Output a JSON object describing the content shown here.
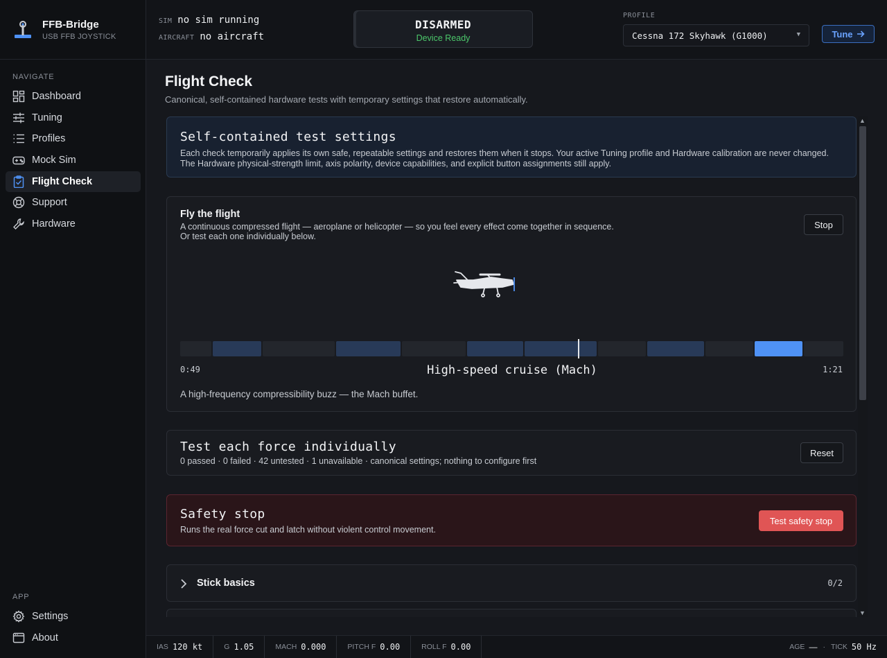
{
  "brand": {
    "name": "FFB-Bridge",
    "subtitle": "USB FFB JOYSTICK"
  },
  "sidebar": {
    "nav_label": "NAVIGATE",
    "items": [
      {
        "label": "Dashboard",
        "icon": "grid-icon"
      },
      {
        "label": "Tuning",
        "icon": "sliders-icon"
      },
      {
        "label": "Profiles",
        "icon": "list-icon"
      },
      {
        "label": "Mock Sim",
        "icon": "gamepad-icon"
      },
      {
        "label": "Flight Check",
        "icon": "clipboard-check-icon",
        "active": true
      },
      {
        "label": "Support",
        "icon": "lifebuoy-icon"
      },
      {
        "label": "Hardware",
        "icon": "wrench-icon"
      }
    ],
    "app_label": "APP",
    "app_items": [
      {
        "label": "Settings",
        "icon": "gear-icon"
      },
      {
        "label": "About",
        "icon": "window-icon"
      }
    ]
  },
  "header": {
    "sim_key": "SIM",
    "sim_value": "no sim running",
    "aircraft_key": "AIRCRAFT",
    "aircraft_value": "no aircraft",
    "arm_state": "DISARMED",
    "arm_status": "Device Ready",
    "profile_label": "PROFILE",
    "profile_value": "Cessna 172 Skyhawk (G1000)",
    "tune_label": "Tune"
  },
  "page": {
    "title": "Flight Check",
    "subtitle": "Canonical, self-contained hardware tests with temporary settings that restore automatically."
  },
  "settings_card": {
    "title": "Self-contained test settings",
    "text": "Each check temporarily applies its own safe, repeatable settings and restores them when it stops. Your active Tuning profile and Hardware calibration are never changed. The Hardware physical-strength limit, axis polarity, device capabilities, and explicit button assignments still apply."
  },
  "flight_card": {
    "title": "Fly the flight",
    "line1": "A continuous compressed flight — aeroplane or helicopter — so you feel every effect come together in sequence.",
    "line2": "Or test each one individually below.",
    "stop_label": "Stop",
    "elapsed": "0:49",
    "total": "1:21",
    "progress_fraction": 0.6,
    "phase": "High-speed cruise (Mach)",
    "phase_desc": "A high-frequency compressibility buzz — the Mach buffet.",
    "colors": {
      "segment_off": "#23262c",
      "segment_on": "#283a58",
      "segment_current": "#4f92f5"
    }
  },
  "individual_card": {
    "title": "Test each force individually",
    "summary": "0 passed · 0 failed · 42 untested · 1 unavailable · canonical settings; nothing to configure first",
    "reset_label": "Reset"
  },
  "safety_card": {
    "title": "Safety stop",
    "text": "Runs the real force cut and latch without violent control movement.",
    "button_label": "Test safety stop"
  },
  "group_card": {
    "title": "Stick basics",
    "count": "0/2"
  },
  "footer": {
    "ias_key": "IAS",
    "ias_val": "120 kt",
    "g_key": "G",
    "g_val": "1.05",
    "mach_key": "MACH",
    "mach_val": "0.000",
    "pitch_key": "PITCH F",
    "pitch_val": "0.00",
    "roll_key": "ROLL F",
    "roll_val": "0.00",
    "age_key": "AGE",
    "age_val": "—",
    "age_sep": "·",
    "tick_key": "TICK",
    "tick_val": "50 Hz"
  }
}
